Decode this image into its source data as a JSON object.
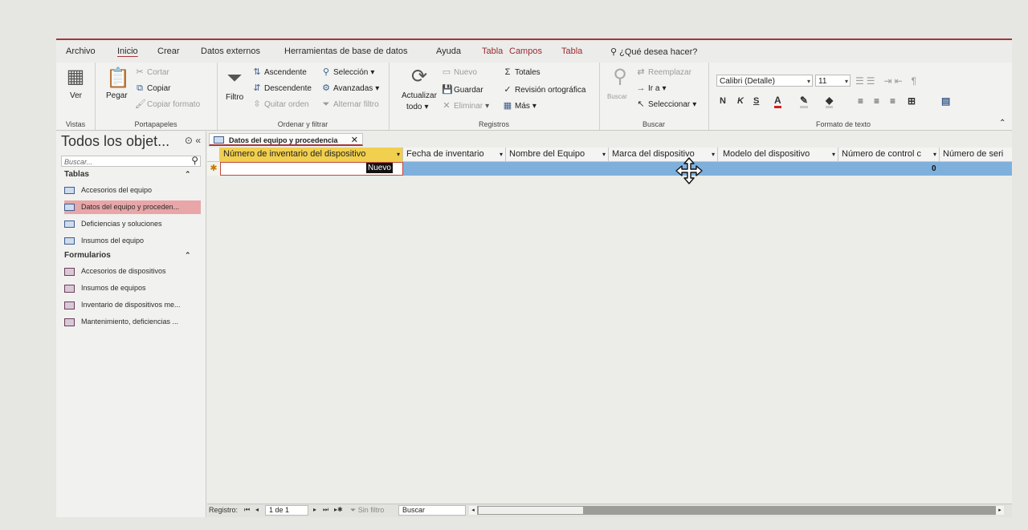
{
  "menu": {
    "tabs": [
      "Archivo",
      "Inicio",
      "Crear",
      "Datos externos",
      "Herramientas de base de datos",
      "Ayuda",
      "Tabla",
      "Campos",
      "Tabla"
    ],
    "search_hint": "¿Qué desea hacer?"
  },
  "ribbon": {
    "vistas": {
      "ver": "Ver",
      "label": "Vistas"
    },
    "portapapeles": {
      "pegar": "Pegar",
      "cortar": "Cortar",
      "copiar": "Copiar",
      "copiar_formato": "Copiar formato",
      "label": "Portapapeles"
    },
    "ordenar": {
      "filtro": "Filtro",
      "ascendente": "Ascendente",
      "descendente": "Descendente",
      "quitar_orden": "Quitar orden",
      "seleccion": "Selección",
      "avanzadas": "Avanzadas",
      "alternar_filtro": "Alternar filtro",
      "label": "Ordenar y filtrar"
    },
    "registros": {
      "actualizar": "Actualizar",
      "todo": "todo",
      "nuevo": "Nuevo",
      "guardar": "Guardar",
      "eliminar": "Eliminar",
      "totales": "Totales",
      "revision": "Revisión ortográfica",
      "mas": "Más",
      "label": "Registros"
    },
    "buscar": {
      "buscar": "Buscar",
      "reemplazar": "Reemplazar",
      "ir_a": "Ir a",
      "seleccionar": "Seleccionar",
      "label": "Buscar"
    },
    "formato": {
      "font": "Calibri (Detalle)",
      "size": "11",
      "bold": "N",
      "italic": "K",
      "underline": "S",
      "label": "Formato de texto"
    }
  },
  "nav": {
    "title": "Todos los objet...",
    "search_placeholder": "Buscar...",
    "sections": [
      {
        "name": "Tablas",
        "items": [
          "Accesorios del equipo",
          "Datos del equipo y proceden...",
          "Deficiencias y soluciones",
          "Insumos del equipo"
        ]
      },
      {
        "name": "Formularios",
        "items": [
          "Accesorios de dispositivos",
          "Insumos de equipos",
          "Inventario de dispositivos me...",
          "Mantenimiento, deficiencias ..."
        ]
      }
    ]
  },
  "document": {
    "tab_title": "Datos del equipo y procedencia",
    "columns": [
      "Número de inventario del dispositivo",
      "Fecha de inventario",
      "Nombre del Equipo",
      "Marca del dispositivo",
      "Modelo del dispositivo",
      "Número de control c",
      "Número de seri"
    ],
    "new_row_label": "Nuevo",
    "default_value": "0"
  },
  "status": {
    "registro": "Registro:",
    "position": "1 de 1",
    "filter": "Sin filtro",
    "search": "Buscar"
  }
}
